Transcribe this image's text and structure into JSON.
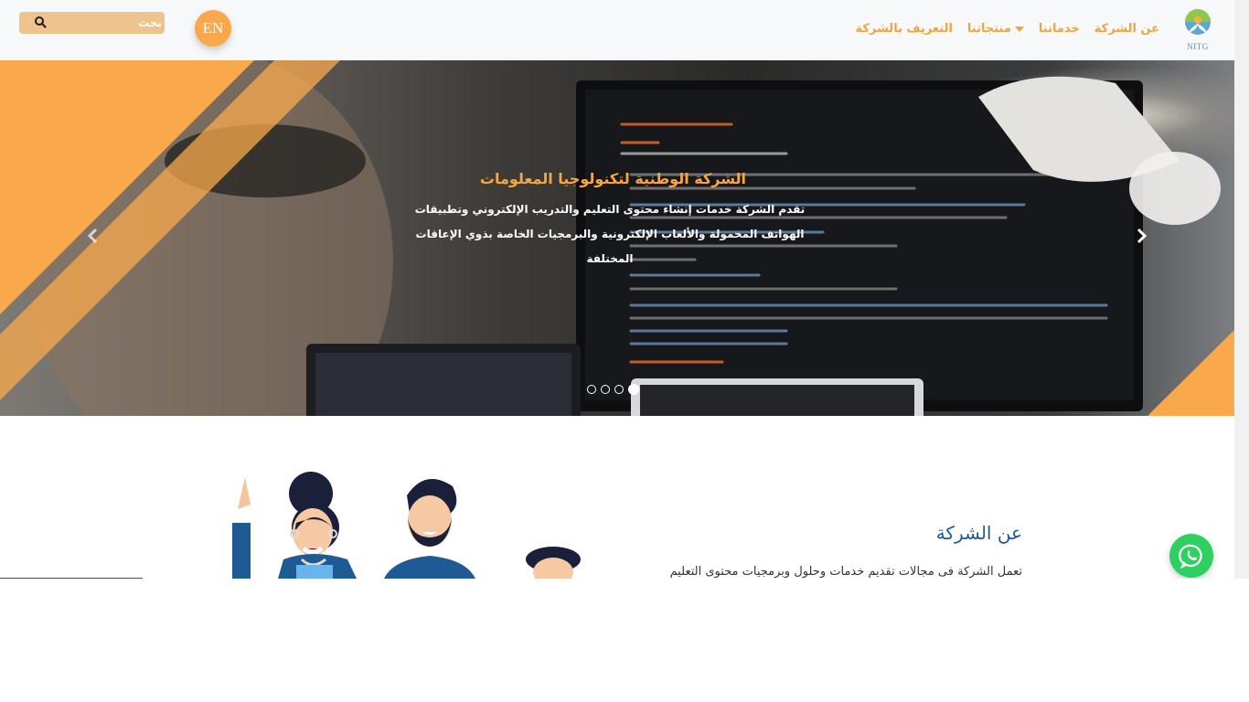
{
  "navbar": {
    "logo_text": "NITG",
    "links": [
      {
        "label": "عن الشركة"
      },
      {
        "label": "خدماتنا"
      },
      {
        "label": "منتجاتنا",
        "has_dropdown": true
      },
      {
        "label": "التعريف بالشركة"
      }
    ],
    "lang_button": "EN",
    "search": {
      "placeholder": "بحث",
      "value": "",
      "icon": "search-icon"
    }
  },
  "hero": {
    "title": "الشركة الوطنية لتكنولوجيا المعلومات",
    "description": "تقدم الشركة خدمات إنشاء محتوى التعليم والتدريب الإلكتروني وتطبيقات الهواتف المحمولة والألعاب الإلكترونية والبرمجيات الخاصة بذوي الإعاقات المختلفة",
    "slide_count": 4,
    "active_slide": 4,
    "prev_icon": "chevron-left-icon",
    "next_icon": "chevron-right-icon"
  },
  "about": {
    "title": "عن الشركة",
    "text": "تعمل الشركة فى مجالات تقديم خدمات وحلول وبرمجيات محتوى التعليم"
  },
  "whatsapp": {
    "icon": "whatsapp-icon"
  },
  "colors": {
    "accent": "#f2a33c",
    "hero_title": "#f7a640",
    "about_title": "#1e5a94",
    "whatsapp": "#2ed061",
    "navbar_bg": "#f7f8fa"
  }
}
